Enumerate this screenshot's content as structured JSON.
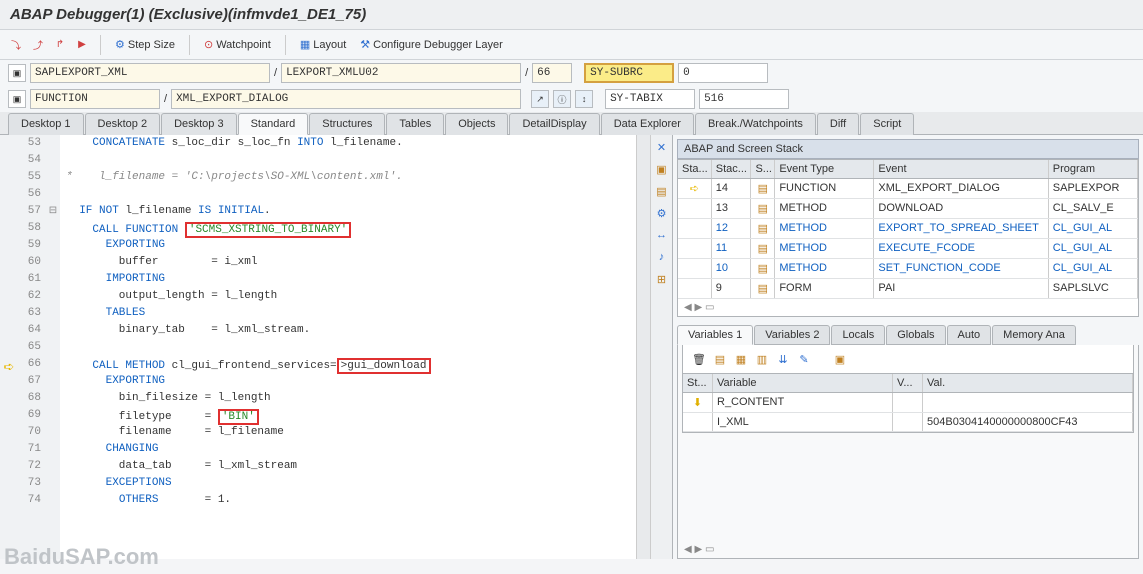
{
  "title": "ABAP Debugger(1)  (Exclusive)(infmvde1_DE1_75)",
  "toolbar": {
    "step_size": "Step Size",
    "watchpoint": "Watchpoint",
    "layout": "Layout",
    "configure": "Configure Debugger Layer"
  },
  "nav": {
    "program": "SAPLEXPORT_XML",
    "include": "LEXPORT_XMLU02",
    "line": "66",
    "subrc_label": "SY-SUBRC",
    "subrc_val": "0",
    "type": "FUNCTION",
    "module": "XML_EXPORT_DIALOG",
    "tabix_label": "SY-TABIX",
    "tabix_val": "516"
  },
  "main_tabs": [
    "Desktop 1",
    "Desktop 2",
    "Desktop 3",
    "Standard",
    "Structures",
    "Tables",
    "Objects",
    "DetailDisplay",
    "Data Explorer",
    "Break./Watchpoints",
    "Diff",
    "Script"
  ],
  "code": {
    "lines": [
      {
        "n": 53,
        "html": "    <span class='kw'>CONCATENATE</span> s_loc_dir s_loc_fn <span class='kw'>INTO</span> l_filename."
      },
      {
        "n": 54,
        "html": ""
      },
      {
        "n": 55,
        "html": "<span class='cmt'>*    l_filename = 'C:\\projects\\SO-XML\\content.xml'.</span>"
      },
      {
        "n": 56,
        "html": ""
      },
      {
        "n": 57,
        "html": "  <span class='kw'>IF NOT</span> l_filename <span class='kw'>IS INITIAL</span>.",
        "fold": "⊟"
      },
      {
        "n": 58,
        "html": "    <span class='kw'>CALL FUNCTION</span> <span class='redbox'><span class='str'>'SCMS_XSTRING_TO_BINARY'</span></span>"
      },
      {
        "n": 59,
        "html": "      <span class='kw'>EXPORTING</span>"
      },
      {
        "n": 60,
        "html": "        buffer        = i_xml"
      },
      {
        "n": 61,
        "html": "      <span class='kw'>IMPORTING</span>"
      },
      {
        "n": 62,
        "html": "        output_length = l_length"
      },
      {
        "n": 63,
        "html": "      <span class='kw'>TABLES</span>"
      },
      {
        "n": 64,
        "html": "        binary_tab    = l_xml_stream."
      },
      {
        "n": 65,
        "html": ""
      },
      {
        "n": 66,
        "html": "    <span class='kw'>CALL METHOD</span> cl_gui_frontend_services=<span class='redbox'>&gt;gui_download</span>",
        "ptr": true
      },
      {
        "n": 67,
        "html": "      <span class='kw'>EXPORTING</span>"
      },
      {
        "n": 68,
        "html": "        bin_filesize = l_length"
      },
      {
        "n": 69,
        "html": "        filetype     = <span class='redbox'><span class='str'>'BIN'</span></span>"
      },
      {
        "n": 70,
        "html": "        filename     = l_filename"
      },
      {
        "n": 71,
        "html": "      <span class='kw'>CHANGING</span>"
      },
      {
        "n": 72,
        "html": "        data_tab     = l_xml_stream"
      },
      {
        "n": 73,
        "html": "      <span class='kw'>EXCEPTIONS</span>"
      },
      {
        "n": 74,
        "html": "        <span class='kw'>OTHERS</span>       = 1."
      }
    ]
  },
  "stack": {
    "title": "ABAP and Screen Stack",
    "cols": [
      "Sta...",
      "Stac...",
      "S...",
      "Event Type",
      "Event",
      "Program"
    ],
    "rows": [
      {
        "ptr": true,
        "lvl": "14",
        "type": "FUNCTION",
        "event": "XML_EXPORT_DIALOG",
        "prog": "SAPLEXPOR"
      },
      {
        "lvl": "13",
        "type": "METHOD",
        "event": "DOWNLOAD",
        "prog": "CL_SALV_E"
      },
      {
        "lvl": "12",
        "type": "METHOD",
        "event": "EXPORT_TO_SPREAD_SHEET",
        "prog": "CL_GUI_AL",
        "sel": true
      },
      {
        "lvl": "11",
        "type": "METHOD",
        "event": "EXECUTE_FCODE",
        "prog": "CL_GUI_AL",
        "sel": true
      },
      {
        "lvl": "10",
        "type": "METHOD",
        "event": "SET_FUNCTION_CODE",
        "prog": "CL_GUI_AL",
        "sel": true
      },
      {
        "lvl": "9",
        "type": "FORM",
        "event": "PAI",
        "prog": "SAPLSLVC"
      }
    ]
  },
  "var_tabs": [
    "Variables 1",
    "Variables 2",
    "Locals",
    "Globals",
    "Auto",
    "Memory Ana"
  ],
  "vars": {
    "cols": [
      "St...",
      "Variable",
      "V...",
      "Val."
    ],
    "rows": [
      {
        "icon": "⬇",
        "name": "R_CONTENT",
        "val": ""
      },
      {
        "icon": "",
        "name": "I_XML",
        "val": "504B0304140000000800CF43"
      }
    ]
  },
  "watermark": "BaiduSAP.com"
}
